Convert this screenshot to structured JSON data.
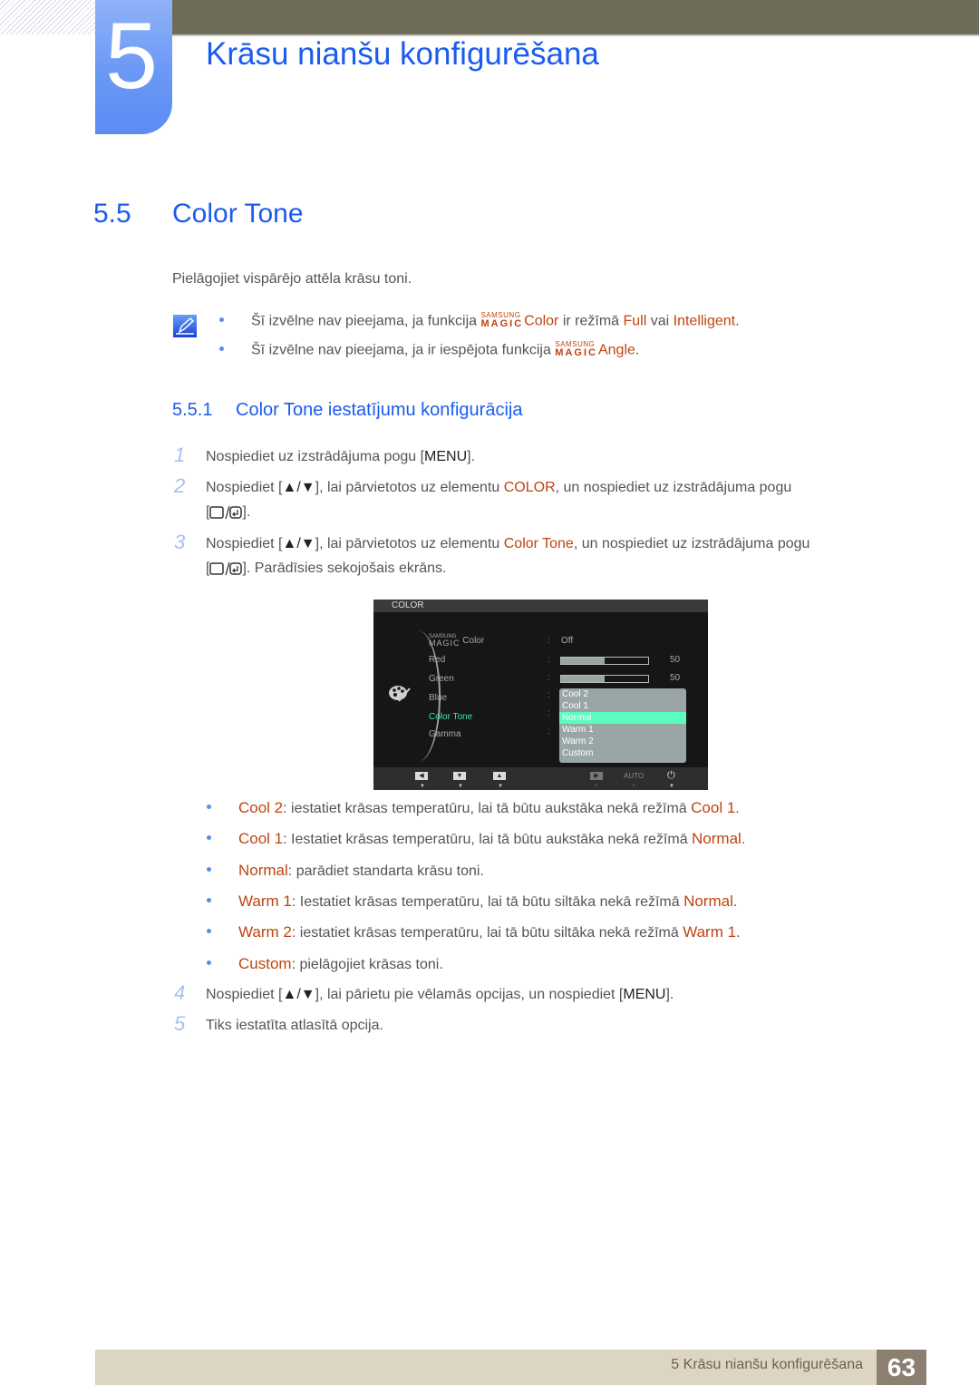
{
  "chapter": {
    "number": "5",
    "title": "Krāsu nianšu konfigurēšana"
  },
  "section": {
    "number": "5.5",
    "title": "Color Tone"
  },
  "intro": "Pielāgojiet vispārējo attēla krāsu toni.",
  "notes": [
    {
      "pre": "Šī izvēlne nav pieejama, ja funkcija ",
      "magic_top": "SAMSUNG",
      "magic_bottom": "MAGIC",
      "feature": "Color",
      "mid": " ir režīmā ",
      "opt1": "Full",
      "or": " vai ",
      "opt2": "Intelligent",
      "end": "."
    },
    {
      "pre": "Šī izvēlne nav pieejama, ja ir iespējota funkcija ",
      "magic_top": "SAMSUNG",
      "magic_bottom": "MAGIC",
      "feature": "Angle",
      "end": "."
    }
  ],
  "subsection": {
    "number": "5.5.1",
    "title": "Color Tone iestatījumu konfigurācija"
  },
  "steps": [
    {
      "num": "1",
      "pre": "Nospiediet uz izstrādājuma pogu [",
      "key": "MENU",
      "post": "]."
    },
    {
      "num": "2",
      "pre": "Nospiediet [",
      "key": "▲/▼",
      "mid": "], lai pārvietotos uz elementu ",
      "target": "COLOR",
      "post": ", un nospiediet uz izstrādājuma pogu",
      "line2_post": "]."
    },
    {
      "num": "3",
      "pre": "Nospiediet [",
      "key": "▲/▼",
      "mid": "], lai pārvietotos uz elementu ",
      "target": "Color Tone",
      "post": ", un nospiediet uz izstrādājuma pogu",
      "line2_post": "]. Parādīsies sekojošais ekrāns."
    },
    {
      "num": "4",
      "pre": "Nospiediet [",
      "key": "▲/▼",
      "mid": "], lai pārietu pie vēlamās opcijas, un nospiediet [",
      "key2": "MENU",
      "post": "]."
    },
    {
      "num": "5",
      "text": "Tiks iestatīta atlasītā opcija."
    }
  ],
  "osd": {
    "header": "COLOR",
    "menu": [
      {
        "label_top": "SAMSUNG",
        "label_bottom": "MAGIC",
        "label": "Color",
        "value": "Off"
      },
      {
        "label": "Red",
        "level": 0.5,
        "value": "50"
      },
      {
        "label": "Green",
        "level": 0.5,
        "value": "50"
      },
      {
        "label": "Blue"
      },
      {
        "label": "Color Tone"
      },
      {
        "label": "Gamma"
      }
    ],
    "dropdown": [
      "Cool 2",
      "Cool 1",
      "Normal",
      "Warm 1",
      "Warm 2",
      "Custom"
    ],
    "selected": "Normal",
    "footer": {
      "auto": "AUTO"
    }
  },
  "options": [
    {
      "name": "Cool 2",
      "text": ": iestatiet krāsas temperatūru, lai tā būtu aukstāka nekā režīmā ",
      "ref": "Cool 1",
      "end": "."
    },
    {
      "name": "Cool 1",
      "text": ": Iestatiet krāsas temperatūru, lai tā būtu aukstāka nekā režīmā ",
      "ref": "Normal",
      "end": "."
    },
    {
      "name": "Normal",
      "text": ": parādiet standarta krāsu toni."
    },
    {
      "name": "Warm 1",
      "text": ": Iestatiet krāsas temperatūru, lai tā būtu siltāka nekā režīmā ",
      "ref": "Normal",
      "end": "."
    },
    {
      "name": "Warm 2",
      "text": ": iestatiet krāsas temperatūru, lai tā būtu siltāka nekā režīmā ",
      "ref": "Warm 1",
      "end": "."
    },
    {
      "name": "Custom",
      "text": ": pielāgojiet krāsas toni."
    }
  ],
  "footer": {
    "text": "5 Krāsu nianšu konfigurēšana",
    "page": "63"
  }
}
